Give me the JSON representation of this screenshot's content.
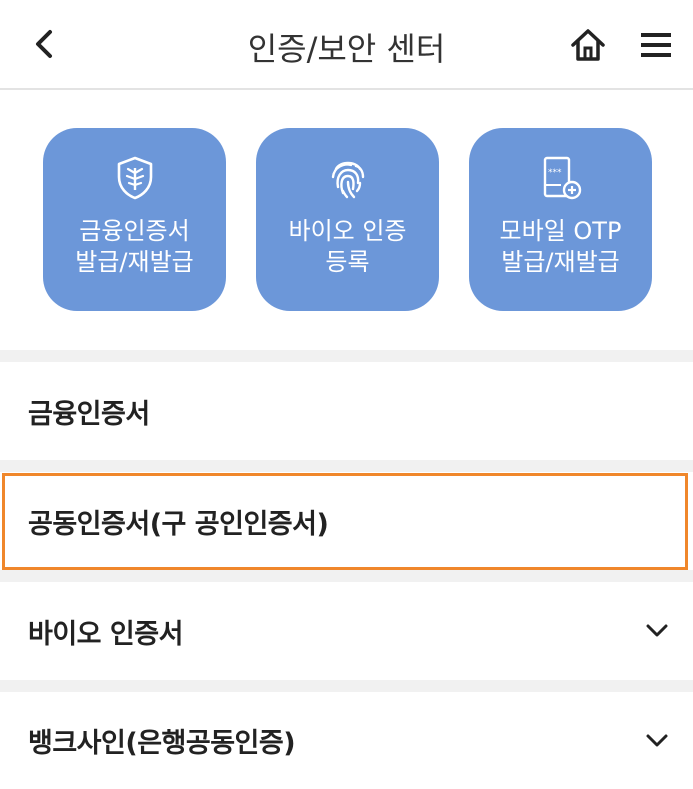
{
  "header": {
    "title": "인증/보안 센터",
    "back_icon": "chevron-left-icon",
    "home_icon": "home-icon",
    "menu_icon": "hamburger-menu-icon"
  },
  "quick_actions": [
    {
      "label": "금융인증서\n발급/재발급",
      "icon": "certificate-shield-icon"
    },
    {
      "label": "바이오 인증\n등록",
      "icon": "fingerprint-icon"
    },
    {
      "label": "모바일 OTP\n발급/재발급",
      "icon": "mobile-otp-icon"
    }
  ],
  "menu": {
    "items": [
      {
        "label": "금융인증서",
        "has_chevron": false
      },
      {
        "label": "공동인증서(구 공인인증서)",
        "has_chevron": false,
        "highlighted": true
      },
      {
        "label": "바이오 인증서",
        "has_chevron": true
      },
      {
        "label": "뱅크사인(은행공동인증)",
        "has_chevron": true
      }
    ]
  },
  "colors": {
    "tile_background": "#6c97d9",
    "highlight_border": "#f0872b",
    "section_gap": "#f1f1f1"
  }
}
